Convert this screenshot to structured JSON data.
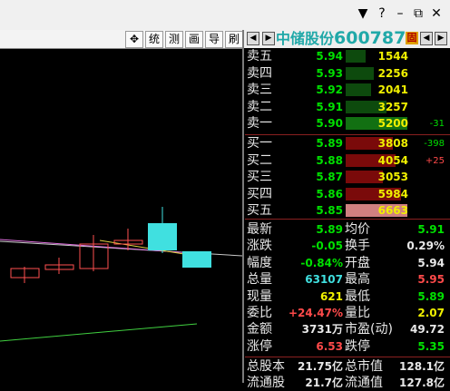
{
  "window": {
    "controls": [
      "▼",
      "?",
      "–",
      "⧉",
      "✕"
    ]
  },
  "toolbar": {
    "move_icon": "crosshair-move-icon",
    "buttons": [
      "统",
      "测",
      "画",
      "导",
      "刷"
    ]
  },
  "stock": {
    "name": "中储股份",
    "code": "600787",
    "badge": "固"
  },
  "sell": [
    {
      "label": "卖五",
      "price": "5.94",
      "volume": "1544",
      "change": "",
      "bar": 0.32
    },
    {
      "label": "卖四",
      "price": "5.93",
      "volume": "2256",
      "change": "",
      "bar": 0.45
    },
    {
      "label": "卖三",
      "price": "5.92",
      "volume": "2041",
      "change": "",
      "bar": 0.41
    },
    {
      "label": "卖二",
      "price": "5.91",
      "volume": "3257",
      "change": "",
      "bar": 0.66
    },
    {
      "label": "卖一",
      "price": "5.90",
      "volume": "5200",
      "change": "-31",
      "bar": 1.0
    }
  ],
  "buy": [
    {
      "label": "买一",
      "price": "5.89",
      "volume": "3808",
      "change": "-398",
      "bar": 0.76
    },
    {
      "label": "买二",
      "price": "5.88",
      "volume": "4054",
      "change": "+25",
      "bar": 0.81
    },
    {
      "label": "买三",
      "price": "5.87",
      "volume": "3053",
      "change": "",
      "bar": 0.61
    },
    {
      "label": "买四",
      "price": "5.86",
      "volume": "5984",
      "change": "",
      "bar": 0.9
    },
    {
      "label": "买五",
      "price": "5.85",
      "volume": "6663",
      "change": "",
      "bar": 1.0
    }
  ],
  "stats": [
    {
      "l1": "最新",
      "v1": "5.89",
      "c1": "green",
      "l2": "均价",
      "v2": "5.91",
      "c2": "green"
    },
    {
      "l1": "涨跌",
      "v1": "-0.05",
      "c1": "green",
      "l2": "换手",
      "v2": "0.29%",
      "c2": "white"
    },
    {
      "l1": "幅度",
      "v1": "-0.84%",
      "c1": "green",
      "l2": "开盘",
      "v2": "5.94",
      "c2": "white"
    },
    {
      "l1": "总量",
      "v1": "63107",
      "c1": "cyan",
      "l2": "最高",
      "v2": "5.95",
      "c2": "red"
    },
    {
      "l1": "现量",
      "v1": "621",
      "c1": "yellow",
      "l2": "最低",
      "v2": "5.89",
      "c2": "green"
    },
    {
      "l1": "委比",
      "v1": "+24.47%",
      "c1": "red",
      "l2": "量比",
      "v2": "2.07",
      "c2": "yellow"
    },
    {
      "l1": "金额",
      "v1": "3731万",
      "c1": "white",
      "l2": "市盈(动)",
      "v2": "49.72",
      "c2": "white"
    },
    {
      "l1": "涨停",
      "v1": "6.53",
      "c1": "red",
      "l2": "跌停",
      "v2": "5.35",
      "c2": "green"
    },
    {
      "l1": "总股本",
      "v1": "21.75亿",
      "c1": "white",
      "l2": "总市值",
      "v2": "128.1亿",
      "c2": "white"
    },
    {
      "l1": "流通股",
      "v1": "21.7亿",
      "c1": "white",
      "l2": "流通值",
      "v2": "127.8亿",
      "c2": "white"
    }
  ],
  "colors": {
    "up": "#ff4a4a",
    "down": "#00e000",
    "cyan": "#40e0e0",
    "sell_bar": "#0d4a0d",
    "buy_bar": "#7a0a0a",
    "highlight_bar": "#d08080"
  }
}
